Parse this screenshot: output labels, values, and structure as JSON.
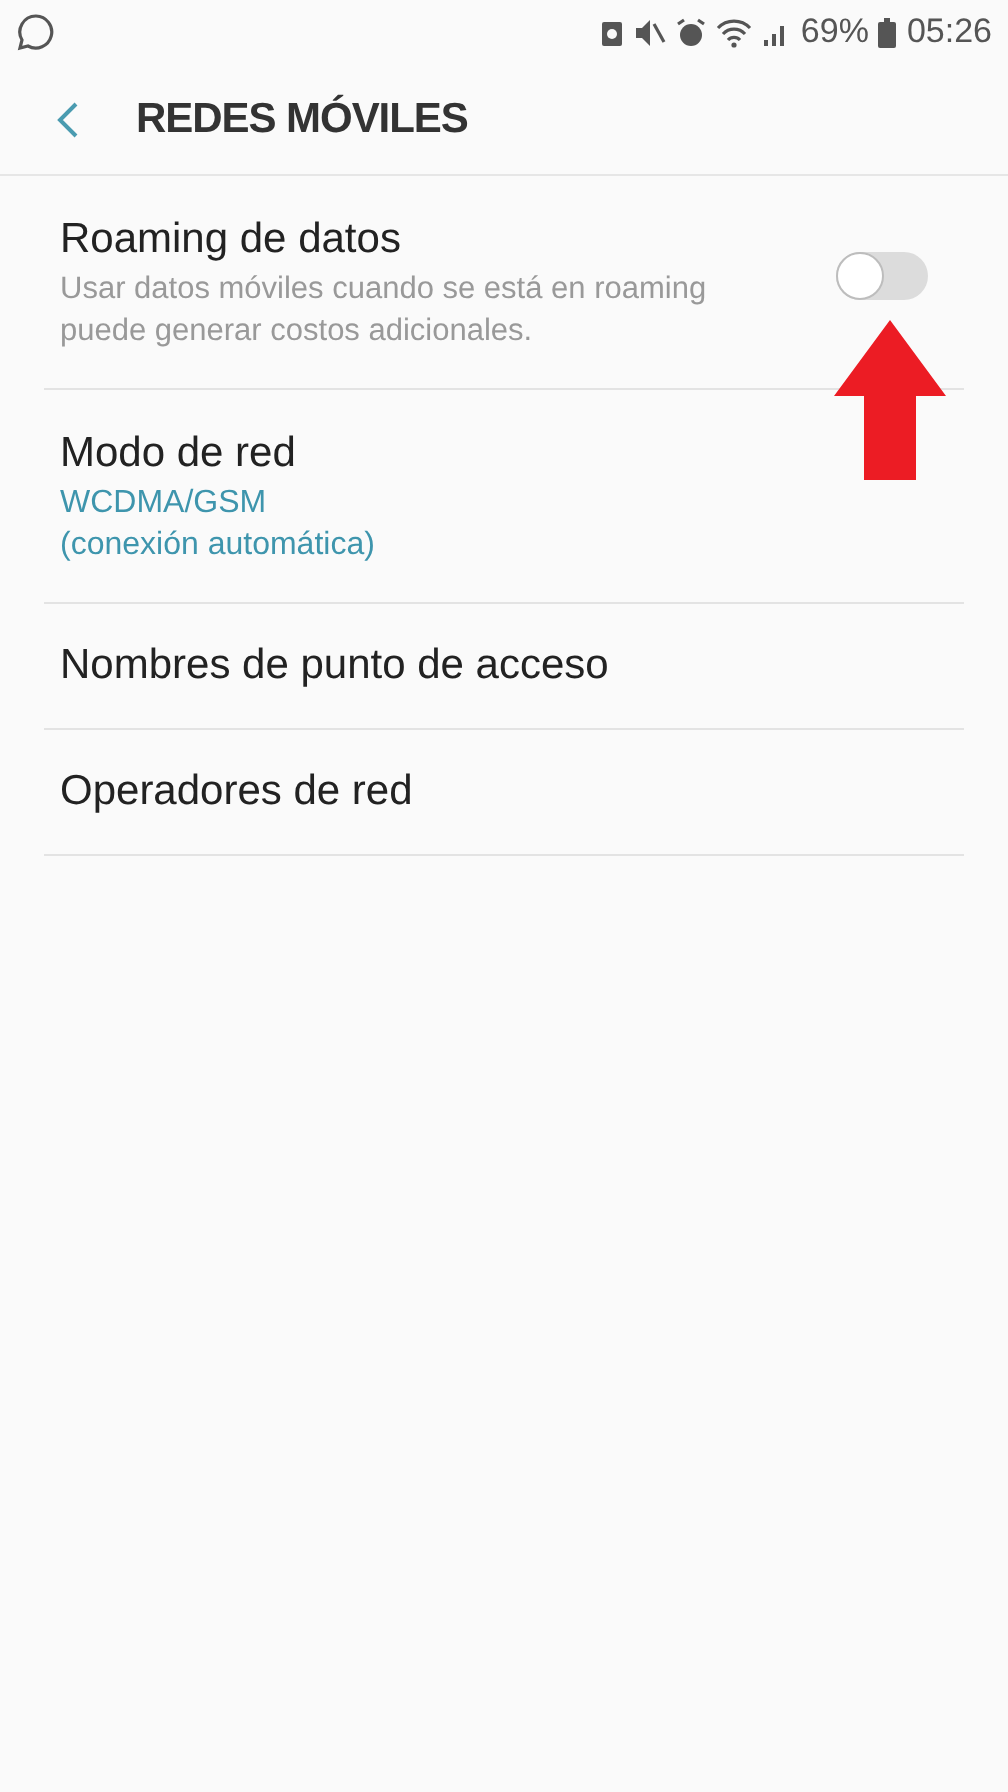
{
  "status_bar": {
    "battery": "69%",
    "time": "05:26"
  },
  "header": {
    "title": "REDES MÓVILES"
  },
  "items": [
    {
      "kind": "switch",
      "title": "Roaming de datos",
      "subtitle": "Usar datos móviles cuando se está en roaming puede generar costos adicionales.",
      "on": false
    },
    {
      "kind": "value",
      "title": "Modo de red",
      "value_lines": [
        "WCDMA/GSM",
        "(conexión automática)"
      ]
    },
    {
      "kind": "plain",
      "title": "Nombres de punto de acceso"
    },
    {
      "kind": "plain",
      "title": "Operadores de red"
    }
  ]
}
